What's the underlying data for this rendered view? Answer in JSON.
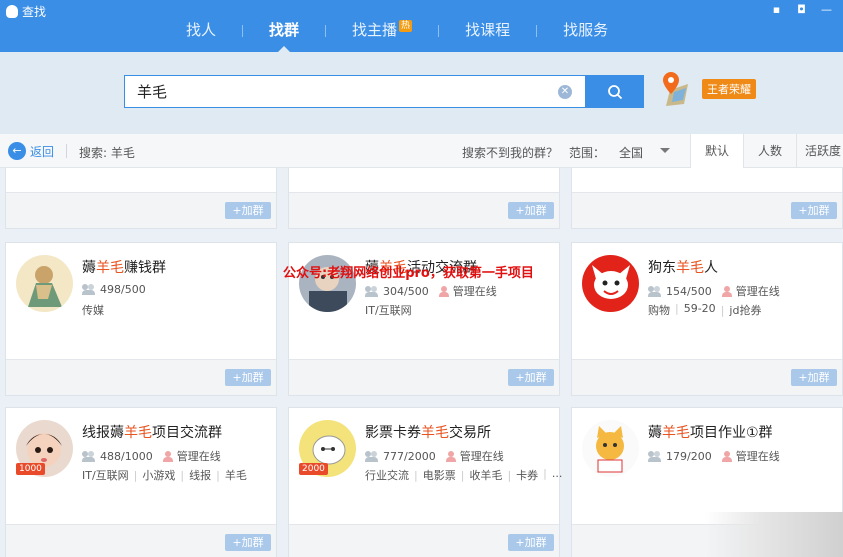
{
  "window": {
    "title": "查找"
  },
  "nav": {
    "tabs": [
      {
        "label": "找人",
        "active": false
      },
      {
        "label": "找群",
        "active": true
      },
      {
        "label": "找主播",
        "badge": "热",
        "active": false
      },
      {
        "label": "找课程",
        "active": false
      },
      {
        "label": "找服务",
        "active": false
      }
    ]
  },
  "search": {
    "value": "羊毛",
    "game_badge": "王者荣耀"
  },
  "filter": {
    "back_label": "返回",
    "search_label": "搜索: 羊毛",
    "not_found": "搜索不到我的群？",
    "range_label": "范围：",
    "range_value": "全国",
    "sort_tabs": [
      {
        "label": "默认",
        "active": true
      },
      {
        "label": "人数",
        "active": false
      },
      {
        "label": "活跃度",
        "active": false
      }
    ]
  },
  "join_label": "+加群",
  "groups": [
    {
      "pre": "薅",
      "hl": "羊毛",
      "post": "赚钱群",
      "members": "498/500",
      "admin": "",
      "tags": [
        "传媒"
      ],
      "avatar": "art"
    },
    {
      "pre": "薅",
      "hl": "羊毛",
      "post": "活动交流群",
      "members": "304/500",
      "admin": "管理在线",
      "tags": [
        "IT/互联网"
      ],
      "avatar": "photo"
    },
    {
      "pre": "狗东",
      "hl": "羊毛",
      "post": "人",
      "members": "154/500",
      "admin": "管理在线",
      "tags": [
        "购物",
        "59-20",
        "jd抢券"
      ],
      "avatar": "jd"
    },
    {
      "pre": "线报薅",
      "hl": "羊毛",
      "post": "项目交流群",
      "members": "488/1000",
      "admin": "管理在线",
      "tags": [
        "IT/互联网",
        "小游戏",
        "线报",
        "羊毛"
      ],
      "avatar": "child",
      "level": "1000"
    },
    {
      "pre": "影票卡券",
      "hl": "羊毛",
      "post": "交易所",
      "members": "777/2000",
      "admin": "管理在线",
      "tags": [
        "行业交流",
        "电影票",
        "收羊毛",
        "卡券",
        "..."
      ],
      "avatar": "cartoon",
      "level": "2000"
    },
    {
      "pre": "薅",
      "hl": "羊毛",
      "post": "项目作业①群",
      "members": "179/200",
      "admin": "管理在线",
      "tags": [],
      "avatar": "cat"
    }
  ],
  "watermark": "公众号:老翔网络创业pro，获取第一手项目",
  "colors": {
    "brand": "#3a8ee6",
    "highlight": "#e8531f",
    "join": "#a9c8ea",
    "badge": "#f08a16"
  }
}
